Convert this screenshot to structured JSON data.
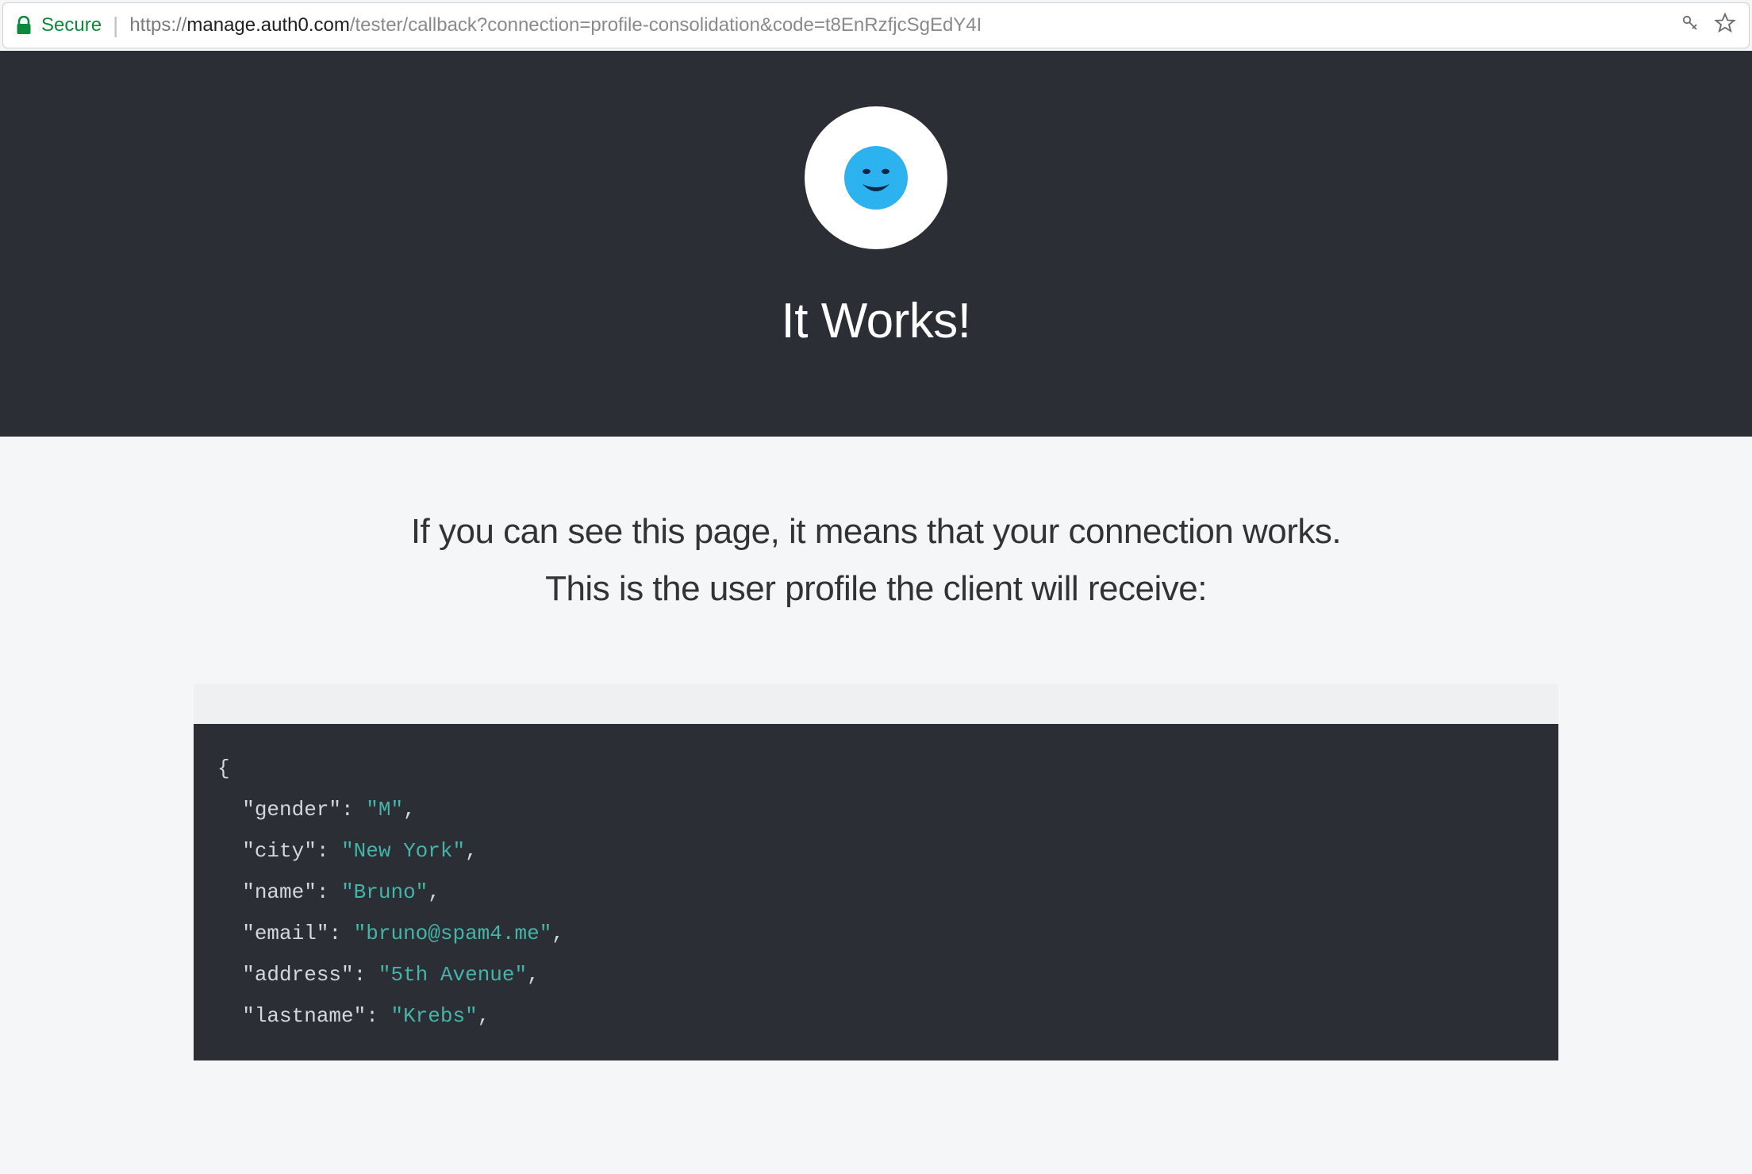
{
  "browser": {
    "secure_label": "Secure",
    "url_scheme": "https://",
    "url_host": "manage.auth0.com",
    "url_path": "/tester/callback?connection=profile-consolidation&code=t8EnRzfjcSgEdY4I"
  },
  "hero": {
    "title": "It Works!"
  },
  "intro": {
    "line1": "If you can see this page, it means that your connection works.",
    "line2": "This is the user profile the client will receive:"
  },
  "profile": {
    "gender": "M",
    "city": "New York",
    "name": "Bruno",
    "email": "bruno@spam4.me",
    "address": "5th Avenue",
    "lastname": "Krebs"
  }
}
